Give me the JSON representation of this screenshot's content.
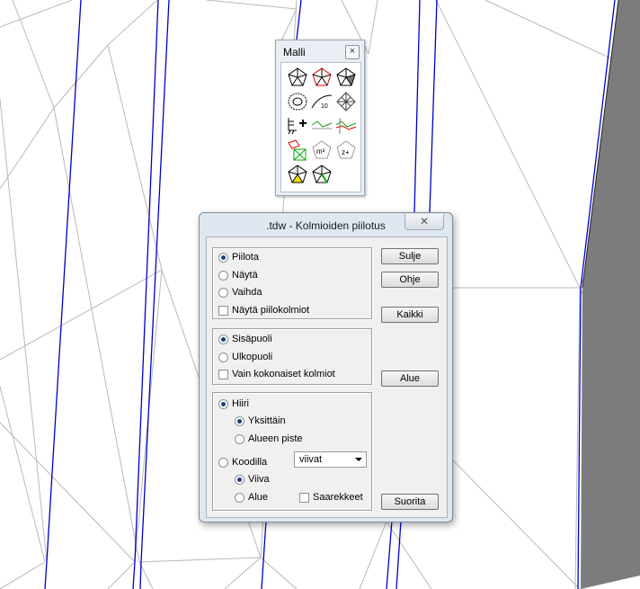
{
  "palette": {
    "title": "Malli",
    "close_icon": "close-icon",
    "tools": [
      {
        "name": "triangle-model-icon"
      },
      {
        "name": "triangle-red-icon"
      },
      {
        "name": "triangle-shaded-icon"
      },
      {
        "name": "contour-icon"
      },
      {
        "name": "contour-label-icon",
        "label": "10"
      },
      {
        "name": "grid-mesh-icon"
      },
      {
        "name": "breakline-add-icon"
      },
      {
        "name": "profile-green-icon"
      },
      {
        "name": "profile-red-icon"
      },
      {
        "name": "volume-boxes-icon"
      },
      {
        "name": "volume-m3-icon",
        "label": "m3"
      },
      {
        "name": "elevation-z-icon",
        "label": "z+"
      },
      {
        "name": "triangle-yellow-icon"
      },
      {
        "name": "triangle-green-icon"
      }
    ]
  },
  "dialog": {
    "title": ".tdw - Kolmioiden piilotus",
    "close_symbol": "✕",
    "group1": {
      "options": [
        "Piilota",
        "Näytä",
        "Vaihda"
      ],
      "selected": 0,
      "checkbox": "Näytä piilokolmiot"
    },
    "group2": {
      "options": [
        "Sisäpuoli",
        "Ulkopuoli"
      ],
      "selected": 0,
      "checkbox": "Vain kokonaiset kolmiot"
    },
    "group3": {
      "hiiri": "Hiiri",
      "yksittain": "Yksittäin",
      "alueen_piste": "Alueen piste",
      "koodilla": "Koodilla",
      "select_value": "viivat",
      "viiva": "Viiva",
      "alue": "Alue",
      "saarekkeet": "Saarekkeet"
    },
    "buttons": {
      "sulje": "Sulje",
      "ohje": "Ohje",
      "kaikki": "Kaikki",
      "alue": "Alue",
      "suorita": "Suorita"
    }
  },
  "colors": {
    "breakline": "#0000cc",
    "triangle_edge": "#b4b4b4",
    "radio_dot": "#1b3f7a"
  }
}
